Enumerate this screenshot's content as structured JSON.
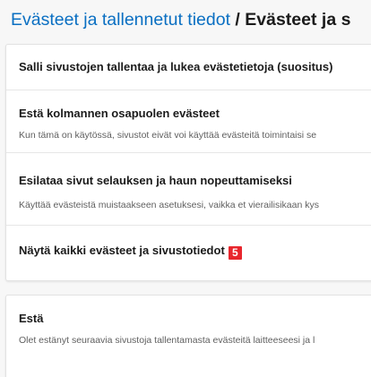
{
  "breadcrumb": {
    "parent": "Evästeet ja tallennetut tiedot",
    "separator": " / ",
    "current": "Evästeet ja s"
  },
  "settings": [
    {
      "title": "Salli sivustojen tallentaa ja lukea evästetietoja (suositus)",
      "description": ""
    },
    {
      "title": "Estä kolmannen osapuolen evästeet",
      "description": "Kun tämä on käytössä, sivustot eivät voi käyttää evästeitä toimintaisi se"
    },
    {
      "title": "Esilataa sivut selauksen ja haun nopeuttamiseksi",
      "description": "Käyttää evästeistä muistaakseen asetuksesi, vaikka et vierailisikaan kys"
    },
    {
      "title": "Näytä kaikki evästeet ja sivustotiedot",
      "badge": "5",
      "badge_color": "#e8262d"
    }
  ],
  "block_section": {
    "title": "Estä",
    "description": "Olet estänyt seuraavia sivustoja tallentamasta evästeitä laitteeseesi ja l"
  },
  "colors": {
    "link": "#0a6fc2",
    "background": "#f7f7f7",
    "card": "#ffffff"
  }
}
